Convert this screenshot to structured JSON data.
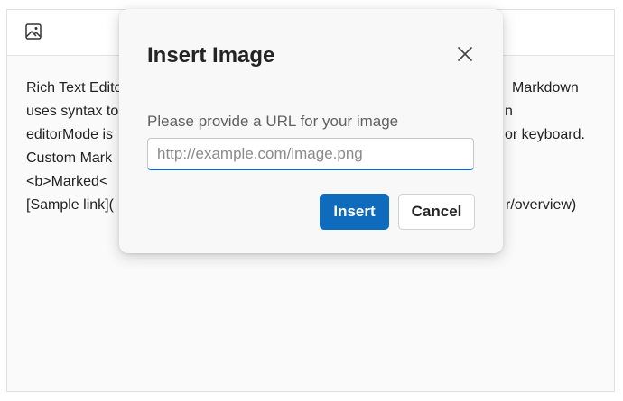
{
  "editor": {
    "toolbar": {
      "image_icon": "image-icon"
    },
    "content": {
      "lines_left": [
        "Rich Text Edito",
        "uses syntax to",
        "editorMode is",
        "Custom Mark",
        "<b>Marked<",
        "[Sample link]("
      ],
      "lines_right": [
        "Markdown",
        "n",
        "or keyboard.",
        "",
        "",
        "r/overview)"
      ]
    }
  },
  "dialog": {
    "title": "Insert Image",
    "close_icon": "close-icon",
    "label": "Please provide a URL for your image",
    "url_input": {
      "placeholder": "http://example.com/image.png",
      "value": ""
    },
    "insert_label": "Insert",
    "cancel_label": "Cancel",
    "accent_color": "#0f6cbd"
  }
}
